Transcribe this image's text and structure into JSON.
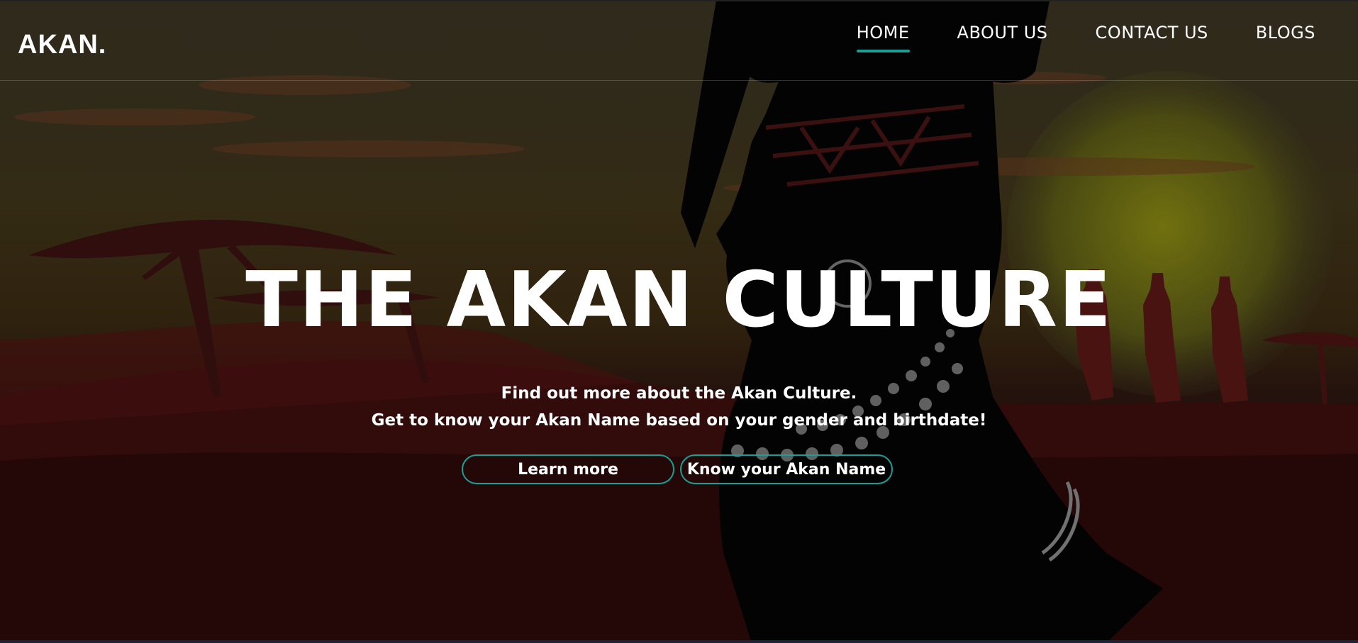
{
  "header": {
    "brand": "AKAN.",
    "nav": [
      {
        "label": "HOME",
        "active": true
      },
      {
        "label": "ABOUT US",
        "active": false
      },
      {
        "label": "CONTACT US",
        "active": false
      },
      {
        "label": "BLOGS",
        "active": false
      }
    ]
  },
  "hero": {
    "title": "THE AKAN CULTURE",
    "subtitle_line1": "Find out more about the Akan Culture.",
    "subtitle_line2": "Get to know your Akan Name based on your gender and birthdate!",
    "buttons": {
      "learn_more": "Learn more",
      "know_name": "Know your Akan Name"
    },
    "background_image": "african-woman-silhouette-sunset"
  },
  "colors": {
    "accent": "#1a9e95",
    "text": "#ffffff"
  }
}
